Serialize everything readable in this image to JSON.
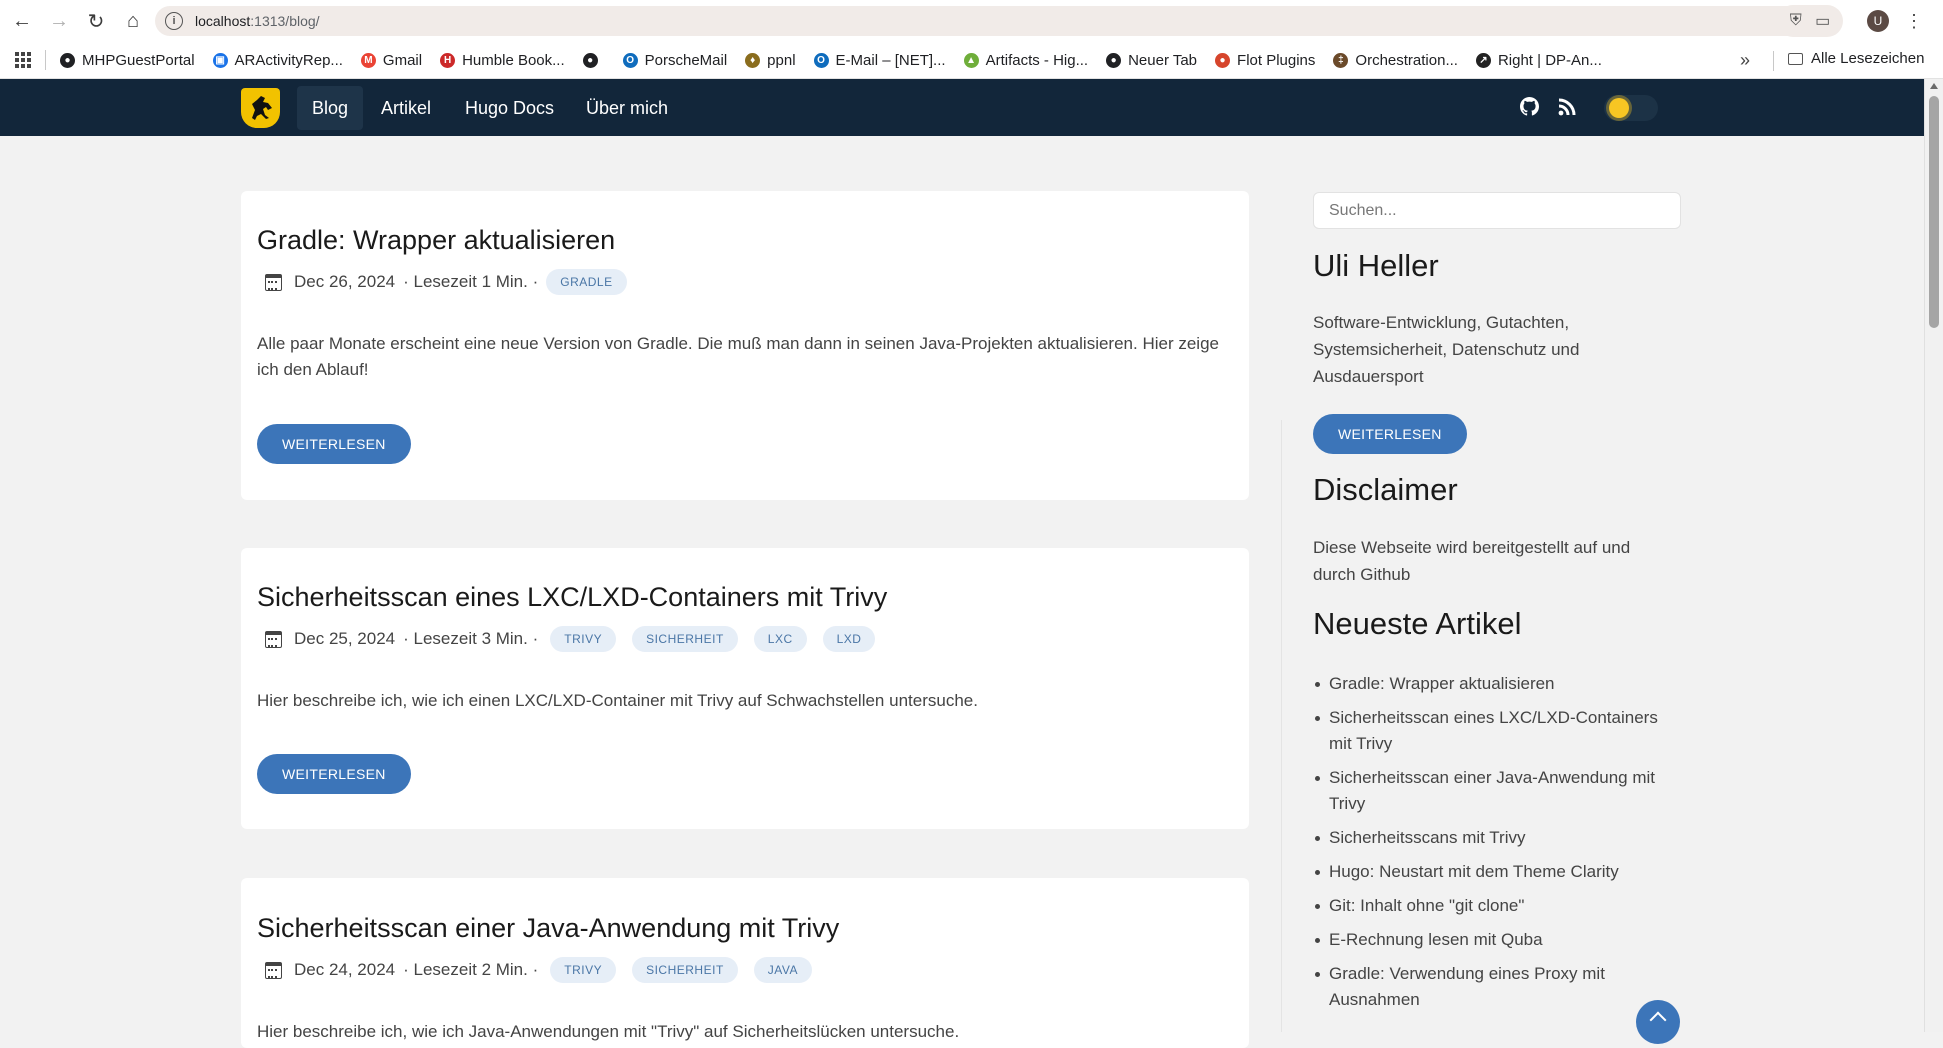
{
  "browser": {
    "url_host": "localhost",
    "url_rest": ":1313/blog/",
    "profile_initial": "U",
    "bookmarks": [
      {
        "label": "MHPGuestPortal",
        "icon": "globe-icon",
        "color": "#202124"
      },
      {
        "label": "ARActivityRep...",
        "icon": "report-icon",
        "color": "#1a73e8"
      },
      {
        "label": "Gmail",
        "icon": "gmail-icon",
        "color": "#ea4335"
      },
      {
        "label": "Humble Book...",
        "icon": "humble-icon",
        "color": "#cc2929"
      },
      {
        "label": "",
        "icon": "globe-icon",
        "color": "#202124"
      },
      {
        "label": "PorscheMail",
        "icon": "outlook-icon",
        "color": "#0f6cbd"
      },
      {
        "label": "ppnl",
        "icon": "porsche-crest-icon",
        "color": "#8a6d1e"
      },
      {
        "label": "E-Mail – [NET]...",
        "icon": "outlook-icon",
        "color": "#0f6cbd"
      },
      {
        "label": "Artifacts - Hig...",
        "icon": "artifacts-icon",
        "color": "#6fae3a"
      },
      {
        "label": "Neuer Tab",
        "icon": "globe-icon",
        "color": "#202124"
      },
      {
        "label": "Flot Plugins",
        "icon": "flot-icon",
        "color": "#d6452c"
      },
      {
        "label": "Orchestration...",
        "icon": "orchestration-icon",
        "color": "#6b4a2a"
      },
      {
        "label": "Right | DP-An...",
        "icon": "right-icon",
        "color": "#222222"
      }
    ],
    "all_bookmarks_label": "Alle Lesezeichen"
  },
  "nav": {
    "items": [
      "Blog",
      "Artikel",
      "Hugo Docs",
      "Über mich"
    ],
    "active": "Blog",
    "accent": "#12263a"
  },
  "posts": [
    {
      "title": "Gradle: Wrapper aktualisieren",
      "date": "Dec 26, 2024",
      "reading": "· Lesezeit 1 Min. ·",
      "tags": [
        "GRADLE"
      ],
      "summary": "Alle paar Monate erscheint eine neue Version von Gradle. Die muß man dann in seinen Java-Projekten aktualisieren. Hier zeige ich den Ablauf!",
      "button": "WEITERLESEN"
    },
    {
      "title": "Sicherheitsscan eines LXC/LXD-Containers mit Trivy",
      "date": "Dec 25, 2024",
      "reading": "· Lesezeit 3 Min. ·",
      "tags": [
        "TRIVY",
        "SICHERHEIT",
        "LXC",
        "LXD"
      ],
      "summary": "Hier beschreibe ich, wie ich einen LXC/LXD-Container mit Trivy auf Schwachstellen untersuche.",
      "button": "WEITERLESEN"
    },
    {
      "title": "Sicherheitsscan einer Java-Anwendung mit Trivy",
      "date": "Dec 24, 2024",
      "reading": "· Lesezeit 2 Min. ·",
      "tags": [
        "TRIVY",
        "SICHERHEIT",
        "JAVA"
      ],
      "summary": "Hier beschreibe ich, wie ich Java-Anwendungen mit \"Trivy\" auf Sicherheitslücken untersuche.",
      "button": ""
    }
  ],
  "sidebar": {
    "search_placeholder": "Suchen...",
    "author_heading": "Uli Heller",
    "author_text": "Software-Entwicklung, Gutachten, Systemsicherheit, Datenschutz und Ausdauersport",
    "author_button": "WEITERLESEN",
    "disclaimer_heading": "Disclaimer",
    "disclaimer_text": "Diese Webseite wird bereitgestellt auf und durch Github",
    "recent_heading": "Neueste Artikel",
    "recent": [
      "Gradle: Wrapper aktualisieren",
      "Sicherheitsscan eines LXC/LXD-Containers mit Trivy",
      "Sicherheitsscan einer Java-Anwendung mit Trivy",
      "Sicherheitsscans mit Trivy",
      "Hugo: Neustart mit dem Theme Clarity",
      "Git: Inhalt ohne \"git clone\"",
      "E-Rechnung lesen mit Quba",
      "Gradle: Verwendung eines Proxy mit Ausnahmen"
    ]
  }
}
